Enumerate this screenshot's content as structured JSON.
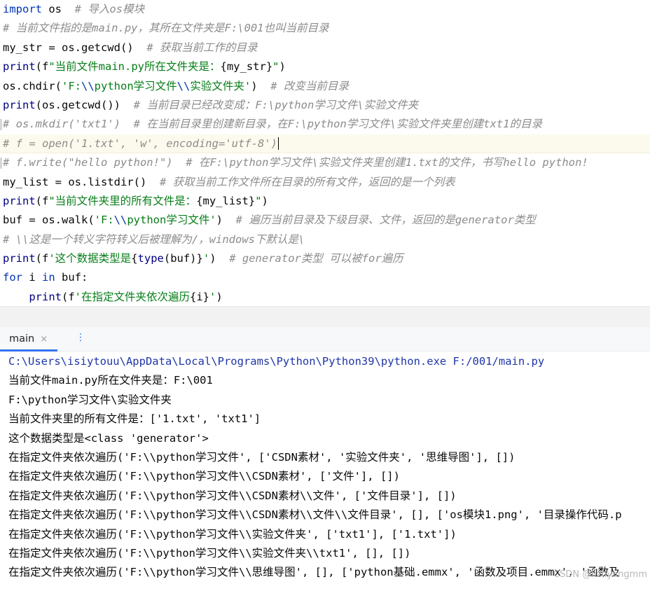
{
  "editor": {
    "lines": [
      [
        {
          "t": "import",
          "c": "kw"
        },
        {
          "t": " os  "
        },
        {
          "t": "# 导入os模块",
          "c": "cm"
        }
      ],
      [
        {
          "t": "# 当前文件指的是main.py，其所在文件夹是F:\\001也叫当前目录",
          "c": "cm"
        }
      ],
      [
        {
          "t": "my_str = os.getcwd()  "
        },
        {
          "t": "# 获取当前工作的目录",
          "c": "cm"
        }
      ],
      [
        {
          "t": "print",
          "c": "fn"
        },
        {
          "t": "(f"
        },
        {
          "t": "\"当前文件main.py所在文件夹是：",
          "c": "str"
        },
        {
          "t": "{my_str}"
        },
        {
          "t": "\"",
          "c": "str"
        },
        {
          "t": ")"
        }
      ],
      [
        {
          "t": "os.chdir("
        },
        {
          "t": "'F:",
          "c": "str"
        },
        {
          "t": "\\\\",
          "c": "esc"
        },
        {
          "t": "python学习文件",
          "c": "str"
        },
        {
          "t": "\\\\",
          "c": "esc"
        },
        {
          "t": "实验文件夹'",
          "c": "str"
        },
        {
          "t": ")  "
        },
        {
          "t": "# 改变当前目录",
          "c": "cm"
        }
      ],
      [
        {
          "t": "print",
          "c": "fn"
        },
        {
          "t": "(os.getcwd())  "
        },
        {
          "t": "# 当前目录已经改变成：F:\\python学习文件\\实验文件夹",
          "c": "cm"
        }
      ],
      [
        {
          "t": "# os.mkdir('txt1')  # 在当前目录里创建新目录，在F:\\python学习文件\\实验文件夹里创建txt1的目录",
          "c": "cm"
        }
      ],
      [
        {
          "t": "# f = open('1.txt', 'w', encoding='utf-8')",
          "c": "cm"
        }
      ],
      [
        {
          "t": "# f.write(\"hello python!\")  # 在F:\\python学习文件\\实验文件夹里创建1.txt的文件，书写hello python!",
          "c": "cm"
        }
      ],
      [
        {
          "t": "my_list = os.listdir()  "
        },
        {
          "t": "# 获取当前工作文件所在目录的所有文件，返回的是一个列表",
          "c": "cm"
        }
      ],
      [
        {
          "t": "print",
          "c": "fn"
        },
        {
          "t": "(f"
        },
        {
          "t": "\"当前文件夹里的所有文件是：",
          "c": "str"
        },
        {
          "t": "{my_list}"
        },
        {
          "t": "\"",
          "c": "str"
        },
        {
          "t": ")"
        }
      ],
      [
        {
          "t": "buf = os.walk("
        },
        {
          "t": "'F:",
          "c": "str"
        },
        {
          "t": "\\\\",
          "c": "esc"
        },
        {
          "t": "python学习文件'",
          "c": "str"
        },
        {
          "t": ")  "
        },
        {
          "t": "# 遍历当前目录及下级目录、文件，返回的是generator类型",
          "c": "cm"
        }
      ],
      [
        {
          "t": "# \\\\这是一个转义字符转义后被理解为/，windows下默认是\\",
          "c": "cm"
        }
      ],
      [
        {
          "t": "print",
          "c": "fn"
        },
        {
          "t": "(f"
        },
        {
          "t": "'这个数据类型是",
          "c": "str"
        },
        {
          "t": "{"
        },
        {
          "t": "type",
          "c": "fn"
        },
        {
          "t": "(buf)}"
        },
        {
          "t": "'",
          "c": "str"
        },
        {
          "t": ")  "
        },
        {
          "t": "# generator类型 可以被for遍历",
          "c": "cm"
        }
      ],
      [
        {
          "t": "for",
          "c": "kw"
        },
        {
          "t": " i "
        },
        {
          "t": "in",
          "c": "kw"
        },
        {
          "t": " buf:"
        }
      ],
      [
        {
          "t": "    "
        },
        {
          "t": "print",
          "c": "fn"
        },
        {
          "t": "(f"
        },
        {
          "t": "'在指定文件夹依次遍历",
          "c": "str"
        },
        {
          "t": "{i}"
        },
        {
          "t": "'",
          "c": "str"
        },
        {
          "t": ")"
        }
      ]
    ]
  },
  "run_panel": {
    "tab_label": "main",
    "close_glyph": "×",
    "more_glyph": "⋮"
  },
  "console": {
    "command": "C:\\Users\\isiytouu\\AppData\\Local\\Programs\\Python\\Python39\\python.exe F:/001/main.py",
    "lines": [
      "当前文件main.py所在文件夹是：F:\\001",
      "F:\\python学习文件\\实验文件夹",
      "当前文件夹里的所有文件是：['1.txt', 'txt1']",
      "这个数据类型是<class 'generator'>",
      "在指定文件夹依次遍历('F:\\\\python学习文件', ['CSDN素材', '实验文件夹', '思维导图'], [])",
      "在指定文件夹依次遍历('F:\\\\python学习文件\\\\CSDN素材', ['文件'], [])",
      "在指定文件夹依次遍历('F:\\\\python学习文件\\\\CSDN素材\\\\文件', ['文件目录'], [])",
      "在指定文件夹依次遍历('F:\\\\python学习文件\\\\CSDN素材\\\\文件\\\\文件目录', [], ['os模块1.png', '目录操作代码.p",
      "在指定文件夹依次遍历('F:\\\\python学习文件\\\\实验文件夹', ['txt1'], ['1.txt'])",
      "在指定文件夹依次遍历('F:\\\\python学习文件\\\\实验文件夹\\\\txt1', [], [])",
      "在指定文件夹依次遍历('F:\\\\python学习文件\\\\思维导图', [], ['python基础.emmx', '函数及项目.emmx', '函数及"
    ]
  },
  "watermark": "CSDN @lizhyangmm"
}
